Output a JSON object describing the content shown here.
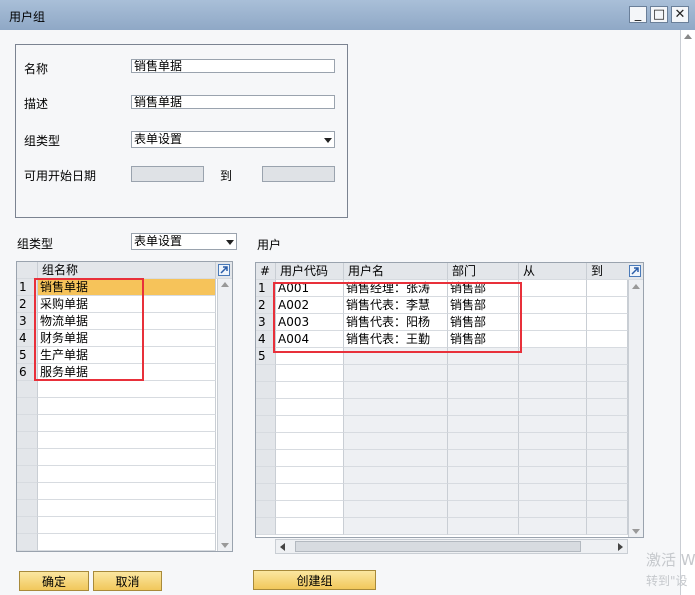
{
  "window": {
    "title": "用户组",
    "minimize": "_",
    "maximize": "□",
    "close": "✕"
  },
  "form": {
    "name_label": "名称",
    "name_value": "销售单据",
    "desc_label": "描述",
    "desc_value": "销售单据",
    "type_label": "组类型",
    "type_value": "表单设置",
    "date_label": "可用开始日期",
    "date_to_label": "到"
  },
  "left": {
    "type_label": "组类型",
    "type_value": "表单设置",
    "header": "组名称",
    "rows": [
      {
        "num": "1",
        "name": "销售单据"
      },
      {
        "num": "2",
        "name": "采购单据"
      },
      {
        "num": "3",
        "name": "物流单据"
      },
      {
        "num": "4",
        "name": "财务单据"
      },
      {
        "num": "5",
        "name": "生产单据"
      },
      {
        "num": "6",
        "name": "服务单据"
      }
    ]
  },
  "right": {
    "label": "用户",
    "headers": [
      "#",
      "用户代码",
      "用户名",
      "部门",
      "从",
      "到"
    ],
    "rows": [
      {
        "num": "1",
        "code": "A001",
        "name": "销售经理：张涛",
        "dept": "销售部"
      },
      {
        "num": "2",
        "code": "A002",
        "name": "销售代表：李慧",
        "dept": "销售部"
      },
      {
        "num": "3",
        "code": "A003",
        "name": "销售代表：阳杨",
        "dept": "销售部"
      },
      {
        "num": "4",
        "code": "A004",
        "name": "销售代表：王勤",
        "dept": "销售部"
      },
      {
        "num": "5",
        "code": "",
        "name": "",
        "dept": ""
      }
    ]
  },
  "buttons": {
    "ok": "确定",
    "cancel": "取消",
    "create_group": "创建组"
  },
  "watermark": {
    "line1": "激活 W",
    "line2": "转到\"设"
  },
  "colors": {
    "selected_row": "#f6c35a",
    "highlight_box": "#e8303a"
  }
}
